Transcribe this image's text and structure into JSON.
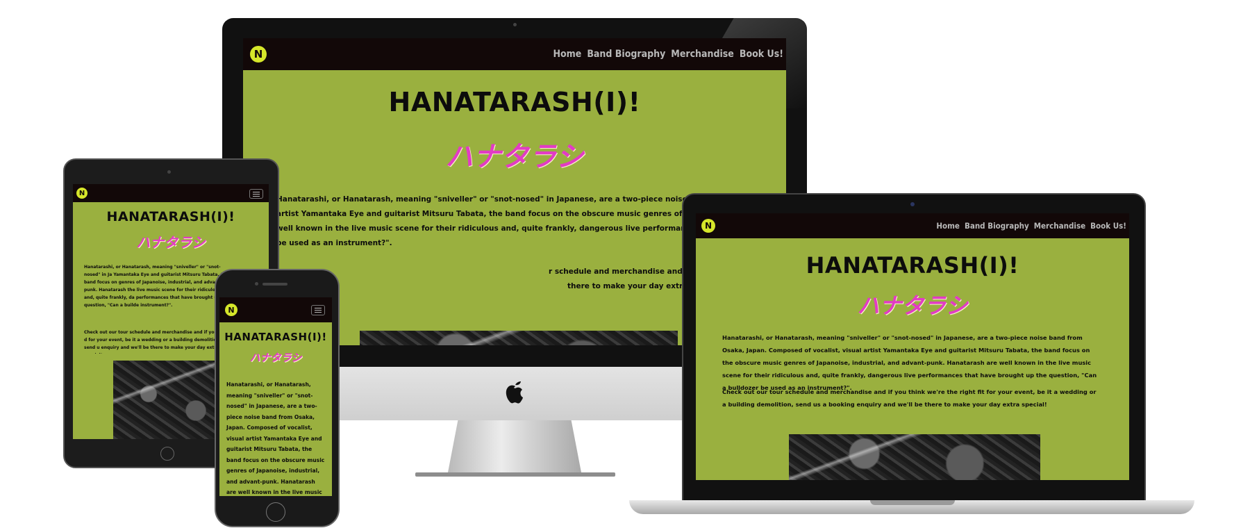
{
  "site": {
    "logo_letter": "N",
    "title": "HANATARASH(I)!",
    "kana": "ハナタラシ",
    "nav": [
      "Home",
      "Band Biography",
      "Merchandise",
      "Book Us!"
    ],
    "paragraph1": "Hanatarashi, or Hanatarash, meaning \"sniveller\" or \"snot-nosed\" in Japanese, are a two-piece noise band from Osaka, Japan. Composed of vocalist, visual artist Yamantaka Eye and guitarist Mitsuru Tabata, the band focus on the obscure music genres of Japanoise, industrial, and advant-punk. Hanatarash are well known in the live music scene for their ridiculous and, quite frankly, dangerous live performances that have brought up the question, \"Can a bulldozer be used as an instrument?\".",
    "paragraph2": "Check out our tour schedule and merchandise and if you think we're the right fit for your event, be it a wedding or a building demolition, send us a booking enquiry and we'll be there to make your day extra special!"
  },
  "desktop": {
    "p1_visible": "Hanatarashi, or Hanatarash, meaning \"sniveller\" or \"snot-nosed\" in Japanese, are a two-piece noise band from Osaka, Japan. Com",
    "p1_line2": "artist Yamantaka Eye and guitarist Mitsuru Tabata, the band focus on the obscure music genres of Japanoise, industrial, and adva",
    "p1_line3": "well known in the live music scene for their ridiculous and, quite frankly, dangerous live performances that have brought up the qu",
    "p1_line4": "be used as an instrument?\".",
    "p2_line1": "r schedule and merchandise and if you think we're the right fit for your event, be it a wedding or a building demol",
    "p2_line2": "there to make your day extra special!"
  },
  "tablet": {
    "p1_visible": "Hanatarashi, or Hanatarash, meaning \"sniveller\" or \"snot-nosed\" in Ja Yamantaka Eye and guitarist Mitsuru Tabata, the band focus on genres of Japanoise, industrial, and advant-punk. Hanatarash the live music scene for their ridiculous and, quite frankly, da performances that have brought up the question, \"Can a builde instrument?\".",
    "p2_visible": "Check out our tour schedule and merchandise and if you think d for your event, be it a wedding or a building demolition, send u enquiry and we'll be there to make your day extra special!"
  },
  "phone": {
    "p1_visible": "Hanatarashi, or Hanatarash, meaning \"sniveller\" or \"snot-nosed\" in Japanese, are a two-piece noise band from Osaka, Japan. Composed of vocalist, visual artist Yamantaka Eye and guitarist Mitsuru Tabata, the band focus on the obscure music genres of Japanoise, industrial, and advant-punk. Hanatarash are well known in the live music scene for their ridiculous and, quite frankly, dangerous live"
  },
  "colors": {
    "nav_bg": "#120808",
    "content_bg": "#9ab03f",
    "accent_pink": "#e23cc4",
    "logo_yellow": "#d6e62a"
  },
  "icons": {
    "logo": "n-circle-logo",
    "apple": "apple-logo",
    "menu": "hamburger-menu-icon"
  }
}
